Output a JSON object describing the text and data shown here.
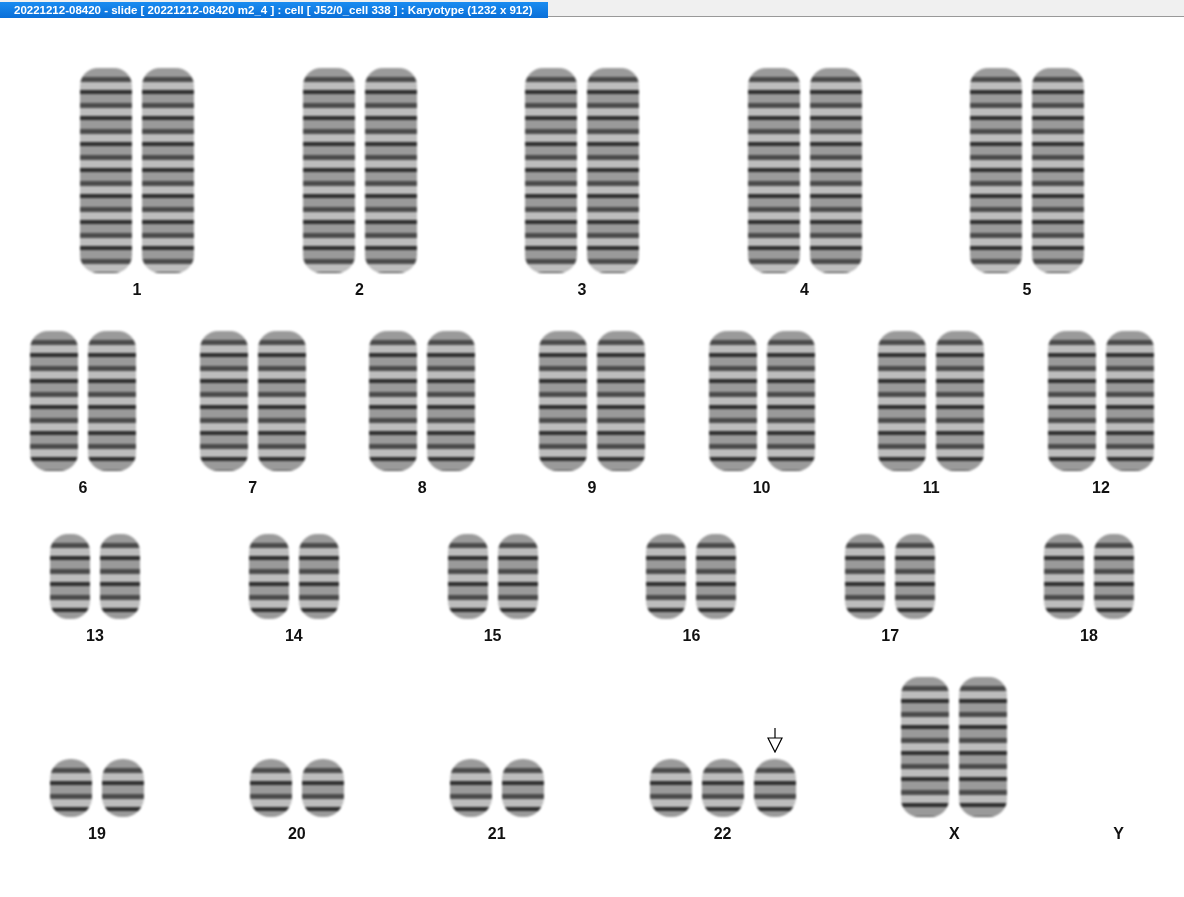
{
  "window": {
    "title": "20221212-08420 - slide [ 20221212-08420 m2_4 ] : cell [ J52/0_cell 338 ] : Karyotype  (1232 x 912)"
  },
  "rows": [
    {
      "groups": [
        {
          "label": "1",
          "chromosomes": [
            {
              "kind": "long"
            },
            {
              "kind": "long"
            }
          ]
        },
        {
          "label": "2",
          "chromosomes": [
            {
              "kind": "long"
            },
            {
              "kind": "long"
            }
          ]
        },
        {
          "label": "3",
          "chromosomes": [
            {
              "kind": "long"
            },
            {
              "kind": "long"
            }
          ]
        },
        {
          "label": "4",
          "chromosomes": [
            {
              "kind": "long"
            },
            {
              "kind": "long"
            }
          ]
        },
        {
          "label": "5",
          "chromosomes": [
            {
              "kind": "long"
            },
            {
              "kind": "long"
            }
          ]
        }
      ]
    },
    {
      "groups": [
        {
          "label": "6",
          "chromosomes": [
            {
              "kind": "medium"
            },
            {
              "kind": "medium"
            }
          ]
        },
        {
          "label": "7",
          "chromosomes": [
            {
              "kind": "medium"
            },
            {
              "kind": "medium"
            }
          ]
        },
        {
          "label": "8",
          "chromosomes": [
            {
              "kind": "medium"
            },
            {
              "kind": "medium"
            }
          ]
        },
        {
          "label": "9",
          "chromosomes": [
            {
              "kind": "medium"
            },
            {
              "kind": "medium"
            }
          ]
        },
        {
          "label": "10",
          "chromosomes": [
            {
              "kind": "medium"
            },
            {
              "kind": "medium"
            }
          ]
        },
        {
          "label": "11",
          "chromosomes": [
            {
              "kind": "medium"
            },
            {
              "kind": "medium"
            }
          ]
        },
        {
          "label": "12",
          "chromosomes": [
            {
              "kind": "medium"
            },
            {
              "kind": "medium"
            }
          ]
        }
      ]
    },
    {
      "groups": [
        {
          "label": "13",
          "chromosomes": [
            {
              "kind": "short"
            },
            {
              "kind": "short"
            }
          ]
        },
        {
          "label": "14",
          "chromosomes": [
            {
              "kind": "short"
            },
            {
              "kind": "short"
            }
          ]
        },
        {
          "label": "15",
          "chromosomes": [
            {
              "kind": "short"
            },
            {
              "kind": "short"
            }
          ]
        },
        {
          "label": "16",
          "chromosomes": [
            {
              "kind": "short"
            },
            {
              "kind": "short"
            }
          ]
        },
        {
          "label": "17",
          "chromosomes": [
            {
              "kind": "short"
            },
            {
              "kind": "short"
            }
          ]
        },
        {
          "label": "18",
          "chromosomes": [
            {
              "kind": "short"
            },
            {
              "kind": "short"
            }
          ]
        }
      ]
    },
    {
      "groups": [
        {
          "label": "19",
          "chromosomes": [
            {
              "kind": "tiny"
            },
            {
              "kind": "tiny"
            }
          ]
        },
        {
          "label": "20",
          "chromosomes": [
            {
              "kind": "tiny"
            },
            {
              "kind": "tiny"
            }
          ]
        },
        {
          "label": "21",
          "chromosomes": [
            {
              "kind": "tiny"
            },
            {
              "kind": "tiny"
            }
          ]
        },
        {
          "label": "22",
          "chromosomes": [
            {
              "kind": "tiny"
            },
            {
              "kind": "tiny"
            },
            {
              "kind": "marked"
            }
          ]
        },
        {
          "label": "X",
          "chromosomes": [
            {
              "kind": "medium"
            },
            {
              "kind": "medium"
            }
          ]
        },
        {
          "label": "Y"
        }
      ]
    }
  ]
}
